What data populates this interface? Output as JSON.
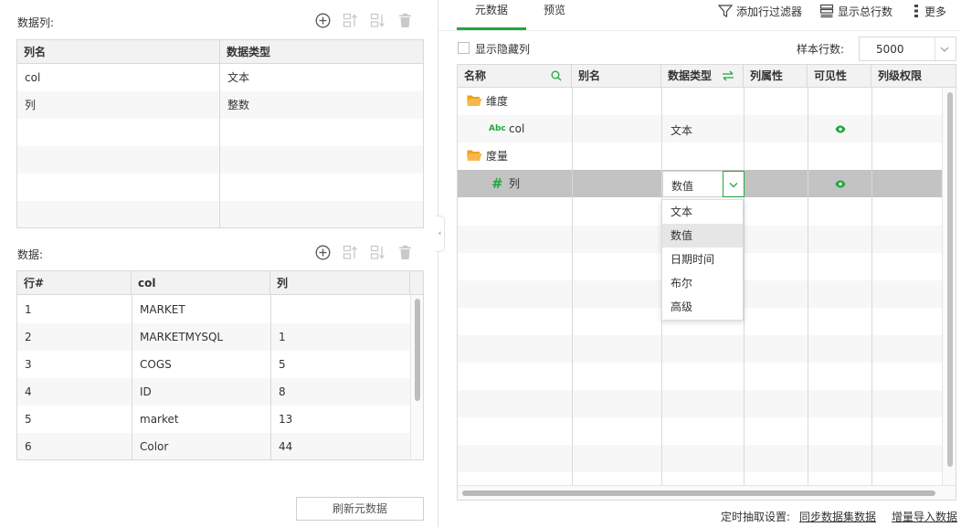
{
  "columns_panel": {
    "label": "数据列:",
    "headers": [
      "列名",
      "数据类型"
    ],
    "rows": [
      [
        "col",
        "文本"
      ],
      [
        "列",
        "整数"
      ]
    ]
  },
  "data_panel": {
    "label": "数据:",
    "headers": [
      "行#",
      "col",
      "列"
    ],
    "rows": [
      [
        "1",
        "MARKET",
        ""
      ],
      [
        "2",
        "MARKETMYSQL",
        "1"
      ],
      [
        "3",
        "COGS",
        "5"
      ],
      [
        "4",
        "ID",
        "8"
      ],
      [
        "5",
        "market",
        "13"
      ],
      [
        "6",
        "Color",
        "44"
      ]
    ]
  },
  "refresh_button": "刷新元数据",
  "tabs": [
    {
      "label": "元数据",
      "active": true
    },
    {
      "label": "预览",
      "active": false
    }
  ],
  "toolbar": {
    "add_filter": "添加行过滤器",
    "show_total": "显示总行数",
    "more": "更多"
  },
  "show_hidden_label": "显示隐藏列",
  "sample_rows_label": "样本行数:",
  "sample_rows_value": "5000",
  "meta_table": {
    "headers": [
      "名称",
      "别名",
      "数据类型",
      "列属性",
      "可见性",
      "列级权限"
    ],
    "group_dimension": "维度",
    "field_col_type_badge": "Abc",
    "field_col_name": "col",
    "field_col_type": "文本",
    "group_measure": "度量",
    "field_measure_symbol": "#",
    "field_measure_name": "列",
    "field_measure_type": "数值"
  },
  "type_dropdown": {
    "options": [
      "文本",
      "数值",
      "日期时间",
      "布尔",
      "高级"
    ],
    "selected": "数值"
  },
  "footer": {
    "schedule_label": "定时抽取设置:",
    "sync_link": "同步数据集数据",
    "incremental_link": "增量导入数据"
  },
  "colors": {
    "accent": "#1fa83f",
    "folder": "#f0a020",
    "selected_row": "#c3c3c3"
  }
}
